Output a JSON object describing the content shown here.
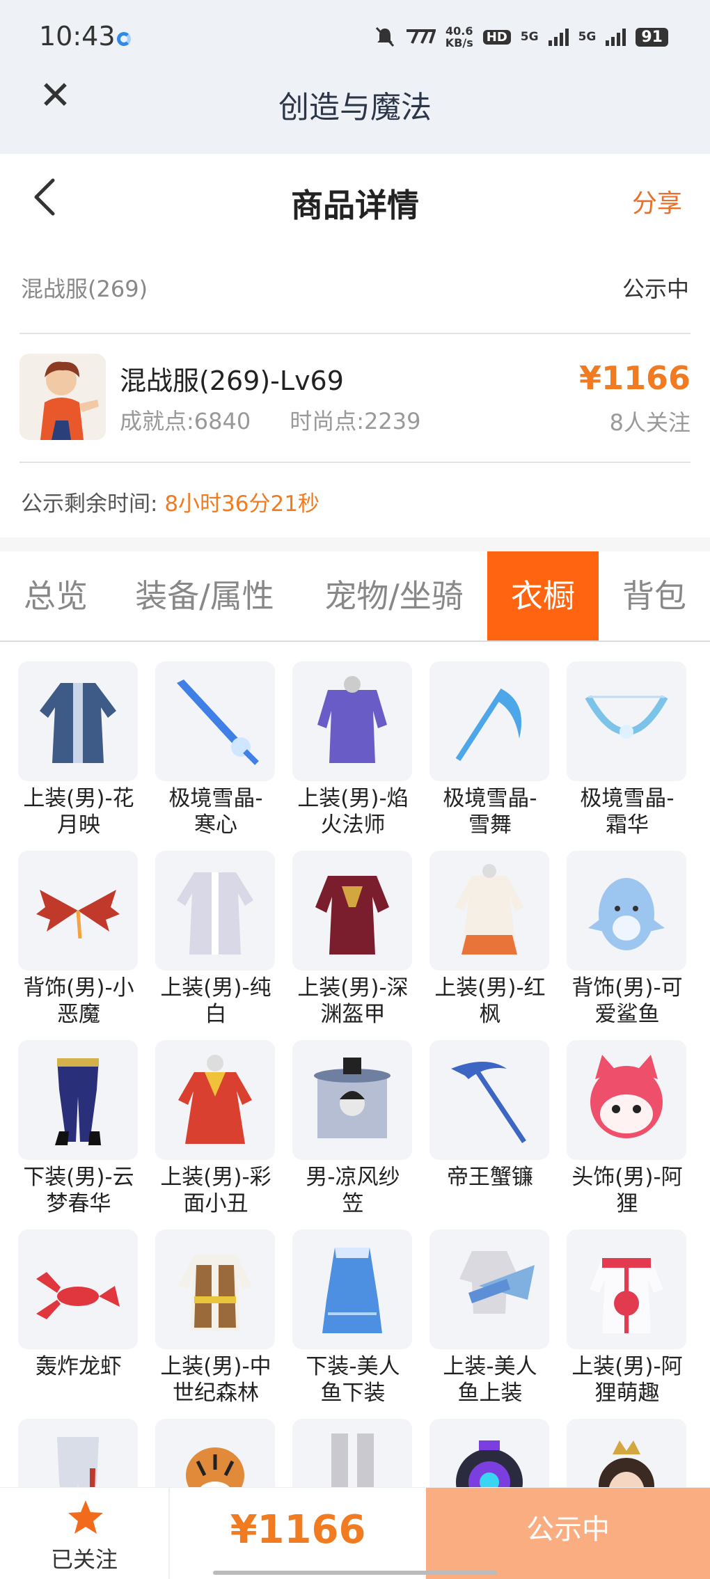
{
  "status_bar": {
    "time": "10:43",
    "speed_top": "40.6",
    "speed_bottom": "KB/s",
    "hd": "HD",
    "net1": "5G",
    "net2": "5G",
    "battery": "91"
  },
  "app_header": {
    "title": "创造与魔法"
  },
  "page_header": {
    "title": "商品详情",
    "share_label": "分享"
  },
  "server": {
    "name": "混战服(269)",
    "status": "公示中"
  },
  "product": {
    "name": "混战服(269)-Lv69",
    "achievement": "成就点:6840",
    "fashion": "时尚点:2239",
    "price": "¥1166",
    "followers": "8人关注"
  },
  "countdown": {
    "label": "公示剩余时间:",
    "value": "8小时36分21秒"
  },
  "tabs": [
    {
      "label": "总览"
    },
    {
      "label": "装备/属性"
    },
    {
      "label": "宠物/坐骑"
    },
    {
      "label": "衣橱"
    },
    {
      "label": "背包"
    }
  ],
  "wardrobe": [
    {
      "line1": "上装(男)-花",
      "line2": "月映",
      "icon": "robe-icon",
      "color": "#3e5a86"
    },
    {
      "line1": "极境雪晶-",
      "line2": "寒心",
      "icon": "ice-sword-icon",
      "color": "#3f7fe6"
    },
    {
      "line1": "上装(男)-焰",
      "line2": "火法师",
      "icon": "armor-icon",
      "color": "#6a5cc7"
    },
    {
      "line1": "极境雪晶-",
      "line2": "雪舞",
      "icon": "ice-scythe-icon",
      "color": "#4da6e8"
    },
    {
      "line1": "极境雪晶-",
      "line2": "霜华",
      "icon": "ice-bow-icon",
      "color": "#7cc3ea"
    },
    {
      "line1": "背饰(男)-小",
      "line2": "恶魔",
      "icon": "devil-wings-icon",
      "color": "#c0392b"
    },
    {
      "line1": "上装(男)-纯",
      "line2": "白",
      "icon": "white-coat-icon",
      "color": "#d8d8e6"
    },
    {
      "line1": "上装(男)-深",
      "line2": "渊盔甲",
      "icon": "dark-armor-icon",
      "color": "#7a1e2e"
    },
    {
      "line1": "上装(男)-红",
      "line2": "枫",
      "icon": "maple-robe-icon",
      "color": "#e8743a"
    },
    {
      "line1": "背饰(男)-可",
      "line2": "爱鲨鱼",
      "icon": "shark-icon",
      "color": "#9cc6ef"
    },
    {
      "line1": "下装(男)-云",
      "line2": "梦春华",
      "icon": "pants-icon",
      "color": "#2a2f7a"
    },
    {
      "line1": "上装(男)-彩",
      "line2": "面小丑",
      "icon": "clown-icon",
      "color": "#d9402f"
    },
    {
      "line1": "男-凉风纱",
      "line2": "笠",
      "icon": "veil-hat-icon",
      "color": "#9aa6c2"
    },
    {
      "line1": "帝王蟹镰",
      "line2": "",
      "icon": "crab-scythe-icon",
      "color": "#3d66c4"
    },
    {
      "line1": "头饰(男)-阿",
      "line2": "狸",
      "icon": "fox-head-icon",
      "color": "#ee4f6b"
    },
    {
      "line1": "轰炸龙虾",
      "line2": "",
      "icon": "lobster-icon",
      "color": "#e0373f"
    },
    {
      "line1": "上装(男)-中",
      "line2": "世纪森林",
      "icon": "vest-icon",
      "color": "#9b6a3b"
    },
    {
      "line1": "下装-美人",
      "line2": "鱼下装",
      "icon": "mermaid-skirt-icon",
      "color": "#4d8fe0"
    },
    {
      "line1": "上装-美人",
      "line2": "鱼上装",
      "icon": "mermaid-top-icon",
      "color": "#7fb0df"
    },
    {
      "line1": "上装(男)-阿",
      "line2": "狸萌趣",
      "icon": "fox-hoodie-icon",
      "color": "#e23a4f"
    },
    {
      "line1": "",
      "line2": "",
      "icon": "white-pants-icon",
      "color": "#d9dde8"
    },
    {
      "line1": "",
      "line2": "",
      "icon": "tiger-icon",
      "color": "#e08a3a"
    },
    {
      "line1": "",
      "line2": "",
      "icon": "boots-icon",
      "color": "#c9c9cf"
    },
    {
      "line1": "",
      "line2": "",
      "icon": "helmet-icon",
      "color": "#7b3fe0"
    },
    {
      "line1": "",
      "line2": "",
      "icon": "crown-hair-icon",
      "color": "#3a2a22"
    }
  ],
  "footer": {
    "follow_label": "已关注",
    "price": "¥1166",
    "action_label": "公示中"
  },
  "colors": {
    "accent": "#f07b20",
    "active_tab": "#ff6411",
    "action_button": "#fbad82"
  }
}
